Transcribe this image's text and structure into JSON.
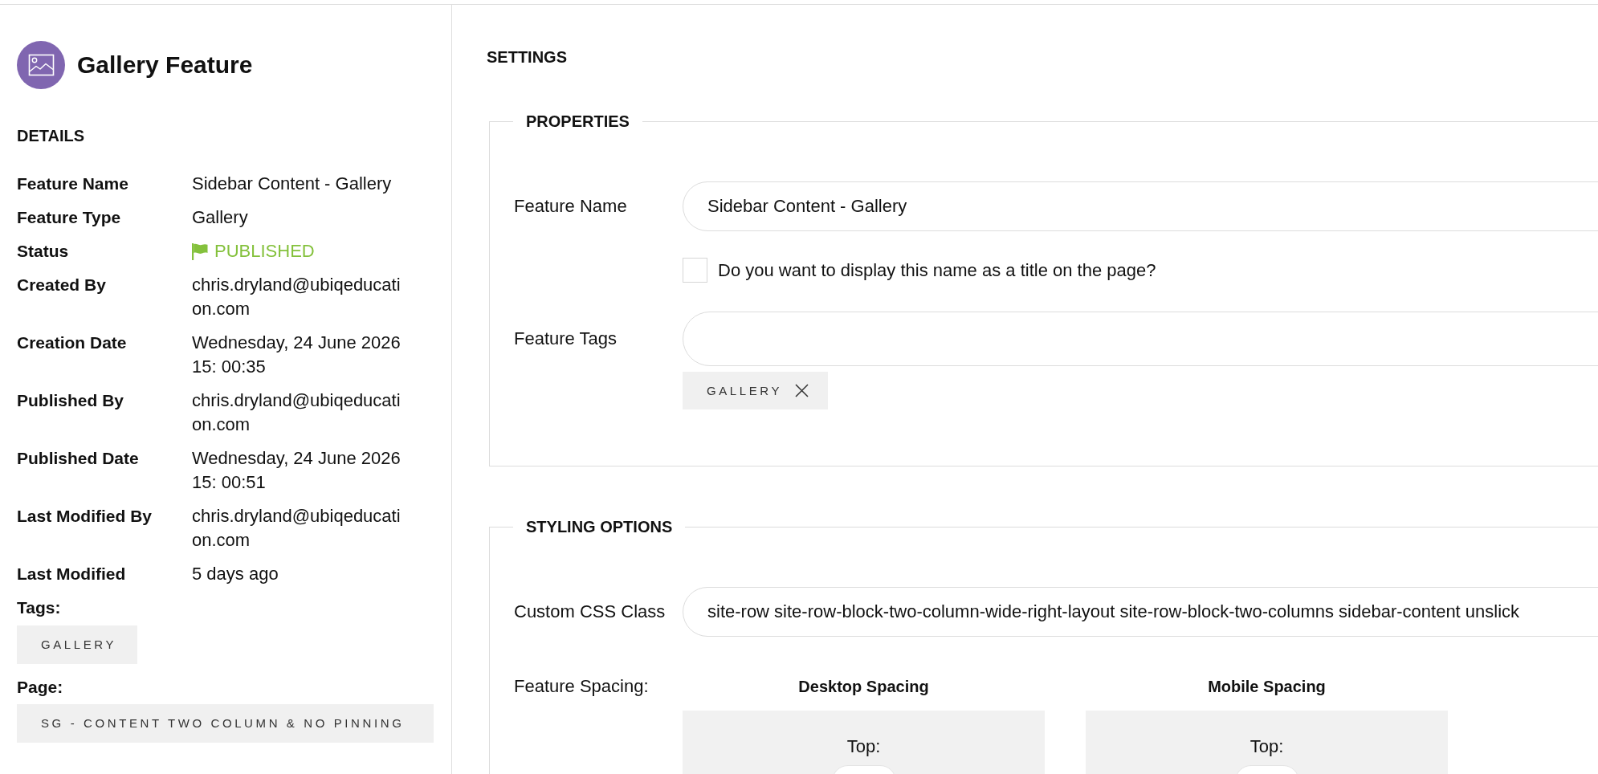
{
  "header": {
    "title": "Gallery Feature"
  },
  "details": {
    "heading": "DETAILS",
    "rows": [
      {
        "kind": "text",
        "label": "Feature Name",
        "value": "Sidebar Content - Gallery"
      },
      {
        "kind": "text",
        "label": "Feature Type",
        "value": "Gallery"
      },
      {
        "kind": "status",
        "label": "Status",
        "value": "PUBLISHED"
      },
      {
        "kind": "text",
        "label": "Created By",
        "value": "chris.dryland@ubiqeducation.com"
      },
      {
        "kind": "text",
        "label": "Creation Date",
        "value": "Wednesday, 24 June 2026 15: 00:35"
      },
      {
        "kind": "text",
        "label": "Published By",
        "value": "chris.dryland@ubiqeducation.com"
      },
      {
        "kind": "text",
        "label": "Published Date",
        "value": "Wednesday, 24 June 2026 15: 00:51"
      },
      {
        "kind": "text",
        "label": "Last Modified By",
        "value": "chris.dryland@ubiqeducation.com"
      },
      {
        "kind": "text",
        "label": "Last Modified",
        "value": "5 days ago"
      }
    ]
  },
  "tags": {
    "label": "Tags:",
    "items": [
      "GALLERY"
    ]
  },
  "page": {
    "label": "Page:",
    "items": [
      "SG - CONTENT TWO COLUMN & NO PINNING"
    ]
  },
  "settings": {
    "heading": "SETTINGS",
    "sections": [
      {
        "legend": "PROPERTIES",
        "fields": [
          {
            "kind": "text",
            "label": "Feature Name",
            "value": "Sidebar Content - Gallery"
          },
          {
            "kind": "checkbox",
            "label": "Do you want to display this name as a title on the page?",
            "checked": false
          },
          {
            "kind": "tags",
            "label": "Feature Tags",
            "tags": [
              "GALLERY"
            ]
          }
        ]
      },
      {
        "legend": "STYLING OPTIONS",
        "fields": [
          {
            "kind": "text",
            "label": "Custom CSS Class",
            "value": "site-row site-row-block-two-column-wide-right-layout site-row-block-two-columns sidebar-content unslick"
          },
          {
            "kind": "spacing",
            "label": "Feature Spacing:",
            "panels": [
              {
                "heading": "Desktop Spacing",
                "field_label": "Top:"
              },
              {
                "heading": "Mobile Spacing",
                "field_label": "Top:"
              }
            ]
          }
        ]
      }
    ]
  }
}
